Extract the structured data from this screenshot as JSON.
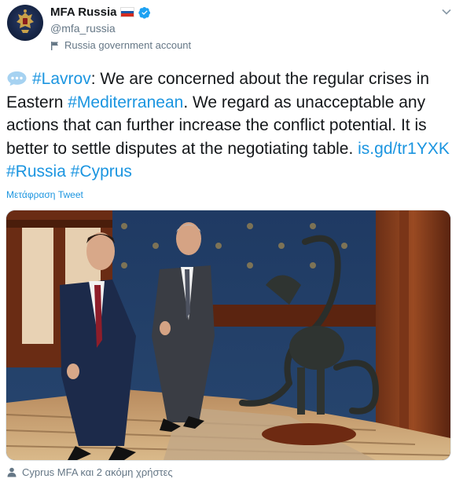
{
  "account": {
    "display_name": "MFA Russia",
    "flag_icon": "russian-flag-emoji",
    "verified_icon": "verified-badge-icon",
    "handle": "@mfa_russia",
    "label": "Russia government account"
  },
  "tweet": {
    "hashtag_lavrov": "#Lavrov",
    "text_1": ": We are concerned about the regular crises in Eastern ",
    "hashtag_mediterranean": "#Mediterranean",
    "text_2": ". We regard as unacceptable any actions that can further increase the conflict potential. It is better to settle disputes at the negotiating table. ",
    "link": "is.gd/tr1YXK",
    "hashtag_russia": "#Russia",
    "hashtag_cyprus": "#Cyprus",
    "translate_label": "Μετάφραση Tweet"
  },
  "photo": {
    "description_icon": "tweet-photo"
  },
  "tagged": {
    "text": "Cyprus MFA και 2 ακόμη χρήστες"
  },
  "colors": {
    "link": "#1b95e0",
    "secondary": "#657786",
    "verified": "#1da1f2"
  }
}
